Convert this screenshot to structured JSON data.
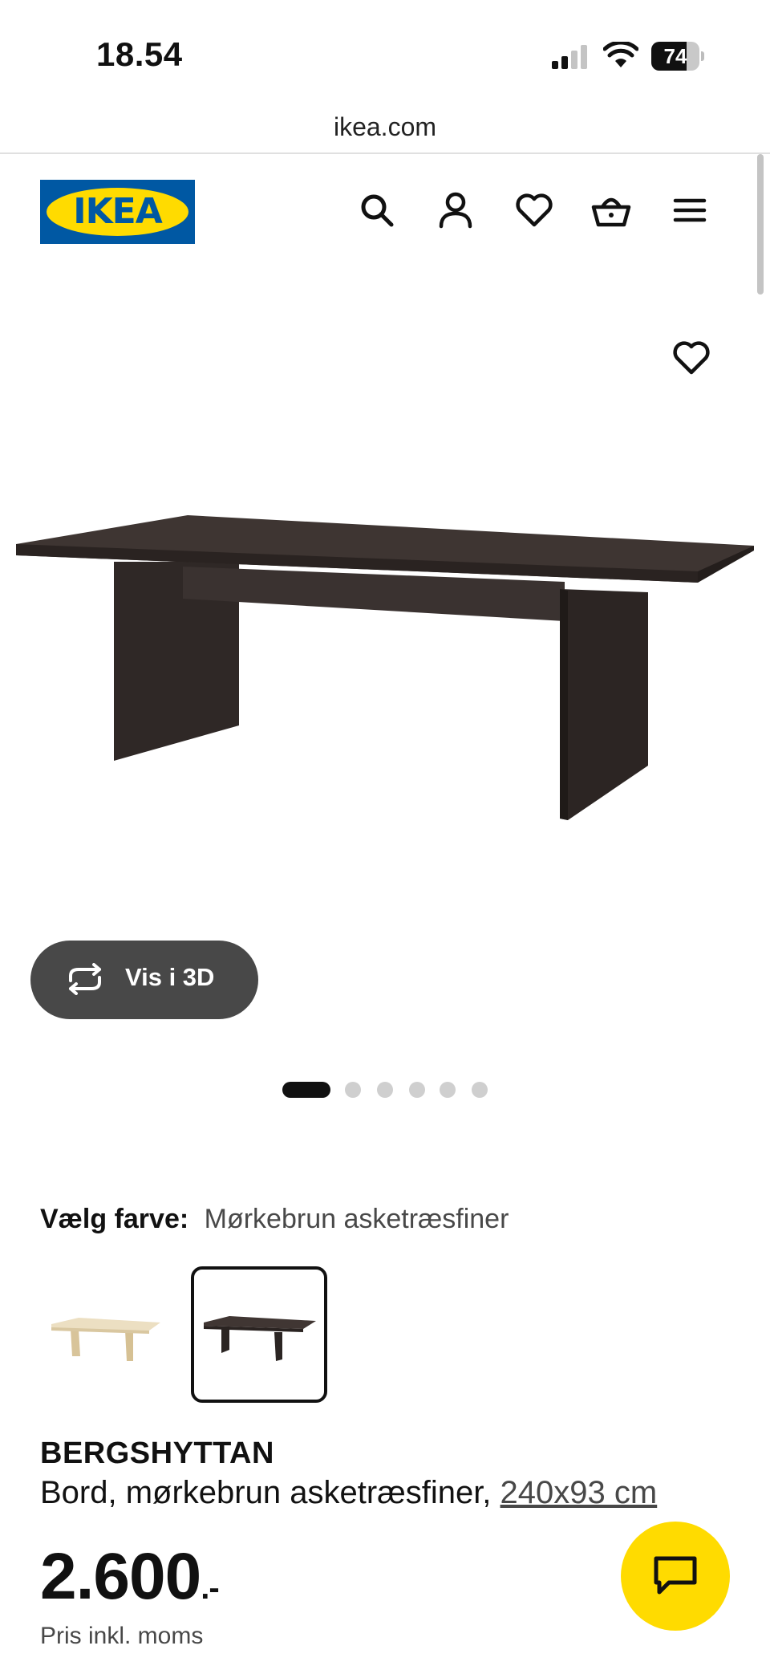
{
  "status_bar": {
    "time": "18.54",
    "battery": "74",
    "battery_level": 0.74
  },
  "browser": {
    "url": "ikea.com"
  },
  "header": {
    "logo_text": "IKEA",
    "icons": [
      "search-icon",
      "user-icon",
      "heart-icon",
      "basket-icon",
      "menu-icon"
    ]
  },
  "product_media": {
    "view_3d_label": "Vis i 3D",
    "image_count": 6,
    "active_image": 1
  },
  "color_picker": {
    "label": "Vælg farve:",
    "selected": "Mørkebrun asketræsfiner",
    "options": [
      {
        "color": "#e9dcc0",
        "selected": false
      },
      {
        "color": "#3c3431",
        "selected": true
      }
    ]
  },
  "product": {
    "name": "BERGSHYTTAN",
    "description": "Bord, mørkebrun asketræsfiner,",
    "dimensions": "240x93 cm",
    "price": "2.600",
    "price_suffix": ".-",
    "price_note": "Pris inkl. moms"
  },
  "colors": {
    "accent_yellow": "#ffdb00",
    "ikea_blue": "#0058a3",
    "table_brown": "#3c3431"
  }
}
